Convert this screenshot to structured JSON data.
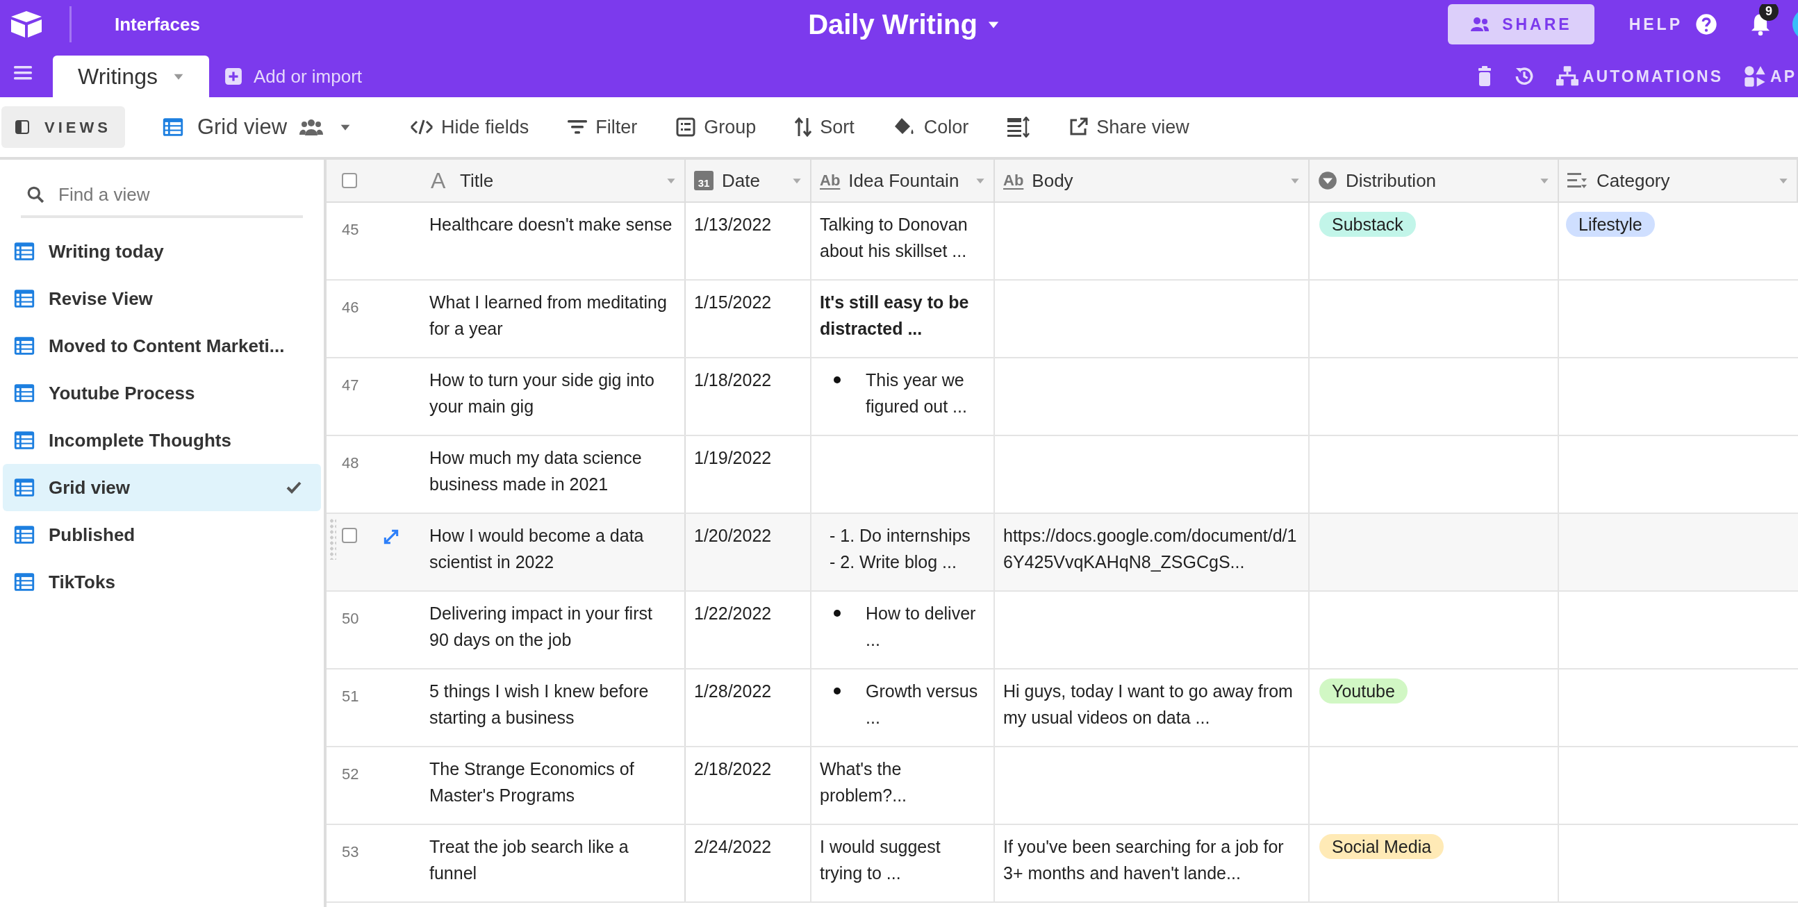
{
  "topbar": {
    "section": "Interfaces",
    "base_title": "Daily Writing",
    "share": "SHARE",
    "help": "HELP",
    "notifications": "9"
  },
  "tabbar": {
    "tabs": [
      {
        "label": "Writings",
        "selected": true
      }
    ],
    "add": "Add or import",
    "automations": "AUTOMATIONS",
    "apps": "AP"
  },
  "toolbar": {
    "views": "VIEWS",
    "current_view": "Grid view",
    "items": [
      {
        "kind": "hide",
        "label": "Hide fields"
      },
      {
        "kind": "filter",
        "label": "Filter"
      },
      {
        "kind": "group",
        "label": "Group"
      },
      {
        "kind": "sort",
        "label": "Sort"
      },
      {
        "kind": "color",
        "label": "Color"
      },
      {
        "kind": "height"
      },
      {
        "kind": "share",
        "label": "Share view"
      }
    ]
  },
  "sidebar": {
    "search": {
      "placeholder": "Find a view"
    },
    "items": [
      {
        "label": "Writing today",
        "selected": false
      },
      {
        "label": "Revise View",
        "selected": false
      },
      {
        "label": "Moved to Content Marketi...",
        "selected": false
      },
      {
        "label": "Youtube Process",
        "selected": false
      },
      {
        "label": "Incomplete Thoughts",
        "selected": false
      },
      {
        "label": "Grid view",
        "selected": true
      },
      {
        "label": "Published",
        "selected": false
      },
      {
        "label": "TikToks",
        "selected": false
      }
    ]
  },
  "table": {
    "select_all": {
      "checked": false
    },
    "columns": [
      {
        "kind": "title",
        "glyph": "A",
        "label": "Title"
      },
      {
        "kind": "date",
        "glyph": "31",
        "label": "Date"
      },
      {
        "kind": "long_text",
        "glyph": "Ab",
        "label": "Idea Fountain"
      },
      {
        "kind": "long_text",
        "glyph": "Ab",
        "label": "Body"
      },
      {
        "kind": "select",
        "label": "Distribution"
      },
      {
        "kind": "multi",
        "label": "Category"
      }
    ],
    "rows": [
      {
        "number": "45",
        "hovered": false,
        "title": "Healthcare doesn't make sense",
        "date": "1/13/2022",
        "idea": {
          "kind": "text",
          "text": "Talking to Donovan about his skillset ..."
        },
        "distribution": {
          "label": "Substack",
          "color": "#c2f5e9"
        },
        "category": {
          "label": "Lifestyle",
          "color": "#cfdfff"
        }
      },
      {
        "number": "46",
        "hovered": false,
        "title": "What I learned from meditating for a year",
        "date": "1/15/2022",
        "idea": {
          "kind": "bold",
          "text": "It's still easy to be distracted ..."
        }
      },
      {
        "number": "47",
        "hovered": false,
        "title": "How to turn your side gig into your main gig",
        "date": "1/18/2022",
        "idea": {
          "kind": "bullet",
          "text": "This year we figured out ..."
        }
      },
      {
        "number": "48",
        "hovered": false,
        "title": "How much my data science business made in 2021",
        "date": "1/19/2022"
      },
      {
        "hovered": true,
        "checked": false,
        "title": "How I would become a data scientist in 2022",
        "date": "1/20/2022",
        "idea": {
          "kind": "lines",
          "text": "- 1. Do internships\n- 2. Write blog ..."
        },
        "body": "https://docs.google.com/document/d/16Y425VvqKAHqN8_ZSGCgS..."
      },
      {
        "number": "50",
        "hovered": false,
        "title": "Delivering impact in your first 90 days on the job",
        "date": "1/22/2022",
        "idea": {
          "kind": "bullet",
          "text": "How to deliver ..."
        }
      },
      {
        "number": "51",
        "hovered": false,
        "title": "5 things I wish I knew before starting a business",
        "date": "1/28/2022",
        "idea": {
          "kind": "bullet",
          "text": "Growth versus ..."
        },
        "body": "Hi guys, today I want to go away from my usual videos on data ...",
        "distribution": {
          "label": "Youtube",
          "color": "#d1f7c4"
        }
      },
      {
        "number": "52",
        "hovered": false,
        "title": "The Strange Economics of Master's Programs",
        "date": "2/18/2022",
        "idea": {
          "kind": "text",
          "text": "What's the problem?..."
        }
      },
      {
        "number": "53",
        "hovered": false,
        "title": "Treat the job search like a funnel",
        "date": "2/24/2022",
        "idea": {
          "kind": "text",
          "text": "I would suggest trying to ..."
        },
        "body": "If you've been searching for a job for 3+ months and haven't lande...",
        "distribution": {
          "label": "Social Media",
          "color": "#ffeab6"
        }
      }
    ]
  }
}
